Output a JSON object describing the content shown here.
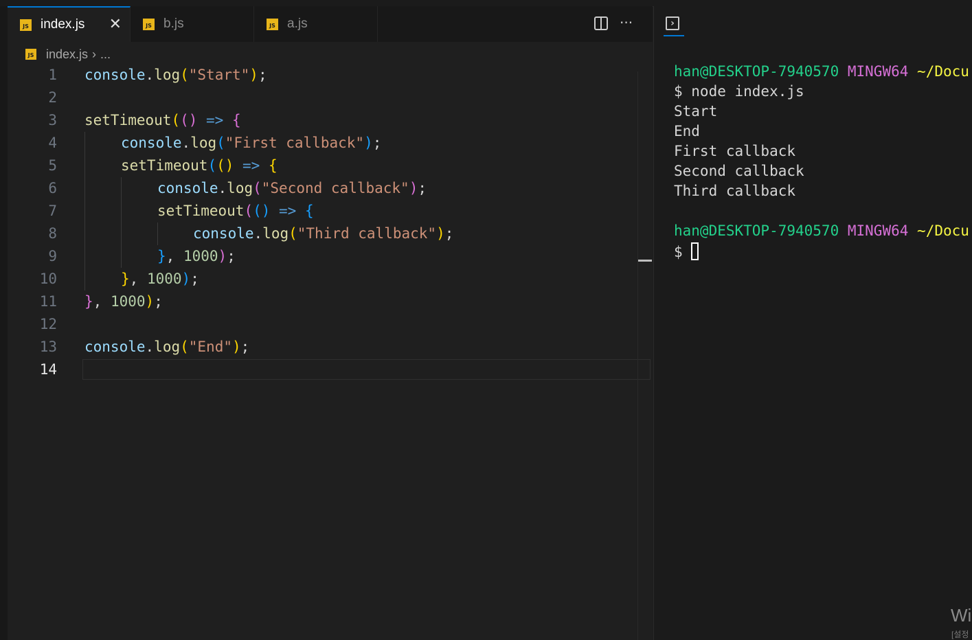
{
  "editor": {
    "tabs": [
      {
        "label": "index.js",
        "badge": "JS",
        "close": "✕"
      },
      {
        "label": "b.js",
        "badge": "JS"
      },
      {
        "label": "a.js",
        "badge": "JS"
      }
    ],
    "actions": {
      "split_icon": "split-editor-icon",
      "more_glyph": "···"
    },
    "breadcrumb": {
      "file": "index.js",
      "separator": "›",
      "more": "..."
    },
    "line_numbers": [
      "1",
      "2",
      "3",
      "4",
      "5",
      "6",
      "7",
      "8",
      "9",
      "10",
      "11",
      "12",
      "13",
      "14"
    ],
    "code": {
      "l1": {
        "obj": "console",
        "dot": ".",
        "fn": "log",
        "open": "(",
        "str": "\"Start\"",
        "close": ")",
        "semi": ";"
      },
      "l3": {
        "fn": "setTimeout",
        "open": "(",
        "args": "()",
        "arrow": " => ",
        "brace": "{"
      },
      "l4": {
        "obj": "console",
        "dot": ".",
        "fn": "log",
        "open": "(",
        "str": "\"First callback\"",
        "close": ")",
        "semi": ";"
      },
      "l5": {
        "fn": "setTimeout",
        "open": "(",
        "args": "()",
        "arrow": " => ",
        "brace": "{"
      },
      "l6": {
        "obj": "console",
        "dot": ".",
        "fn": "log",
        "open": "(",
        "str": "\"Second callback\"",
        "close": ")",
        "semi": ";"
      },
      "l7": {
        "fn": "setTimeout",
        "open": "(",
        "args": "()",
        "arrow": " => ",
        "brace": "{"
      },
      "l8": {
        "obj": "console",
        "dot": ".",
        "fn": "log",
        "open": "(",
        "str": "\"Third callback\"",
        "close": ")",
        "semi": ";"
      },
      "l9": {
        "brace": "}",
        "comma": ", ",
        "num": "1000",
        "close": ")",
        "semi": ";"
      },
      "l10": {
        "brace": "}",
        "comma": ", ",
        "num": "1000",
        "close": ")",
        "semi": ";"
      },
      "l11": {
        "brace": "}",
        "comma": ", ",
        "num": "1000",
        "close": ")",
        "semi": ";"
      },
      "l13": {
        "obj": "console",
        "dot": ".",
        "fn": "log",
        "open": "(",
        "str": "\"End\"",
        "close": ")",
        "semi": ";"
      }
    }
  },
  "terminal": {
    "icon": "terminal-panel-icon",
    "prompt_user": "han@DESKTOP-7940570",
    "prompt_env": "MINGW64",
    "prompt_path": "~/Docu",
    "command_line": "$ node index.js",
    "output": [
      "Start",
      "End",
      "First callback",
      "Second callback",
      "Third callback"
    ],
    "dollar": "$"
  },
  "watermark": {
    "title": "Wi",
    "subtitle": "[설정"
  },
  "colors": {
    "accent": "#0078d4",
    "js_badge": "#e8b51a",
    "string": "#ce9178",
    "function": "#dcdcaa",
    "variable": "#9cdcfe",
    "number": "#b5cea8",
    "term_green": "#23d18b",
    "term_magenta": "#d670d6",
    "term_yellow": "#f5f543"
  }
}
